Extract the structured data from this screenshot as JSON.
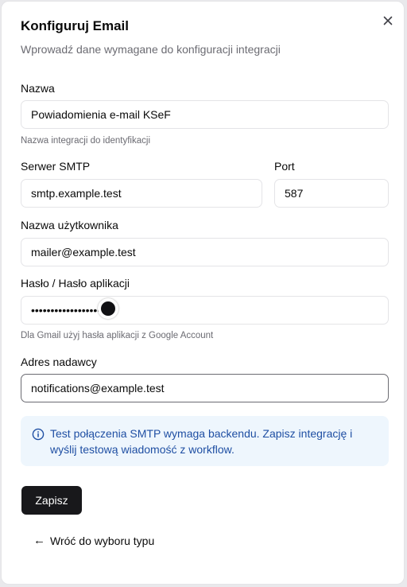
{
  "dialog": {
    "title": "Konfiguruj Email",
    "subtitle": "Wprowadź dane wymagane do konfiguracji integracji"
  },
  "fields": {
    "name": {
      "label": "Nazwa",
      "value": "Powiadomienia e-mail KSeF",
      "hint": "Nazwa integracji do identyfikacji"
    },
    "smtp_server": {
      "label": "Serwer SMTP",
      "value": "smtp.example.test"
    },
    "port": {
      "label": "Port",
      "value": "587"
    },
    "username": {
      "label": "Nazwa użytkownika",
      "value": "mailer@example.test"
    },
    "password": {
      "label": "Hasło / Hasło aplikacji",
      "masked_value": "•••••••••••••••••••••",
      "hint": "Dla Gmail użyj hasła aplikacji z Google Account"
    },
    "sender": {
      "label": "Adres nadawcy",
      "value": "notifications@example.test"
    }
  },
  "info": {
    "text": "Test połączenia SMTP wymaga backendu. Zapisz integrację i wyślij testową wiadomość z workflow.",
    "color": "#1f4fa3",
    "background": "#eef6fd"
  },
  "actions": {
    "save_label": "Zapisz",
    "back_label": "Wróć do wyboru typu",
    "back_arrow": "←"
  },
  "colors": {
    "primary_button": "#18181b",
    "muted_text": "#6b6b72",
    "border": "#e4e4e7"
  }
}
